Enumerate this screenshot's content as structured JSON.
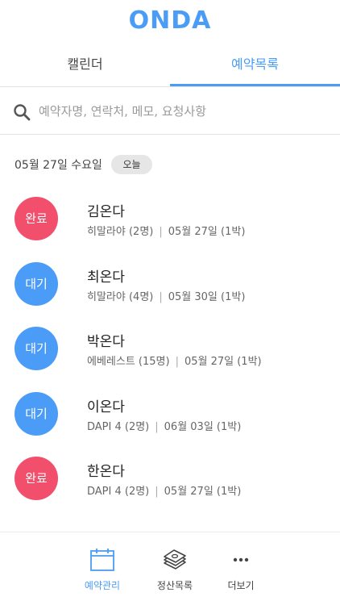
{
  "app": {
    "logo": "ONDA"
  },
  "tabs": [
    {
      "label": "캘린더"
    },
    {
      "label": "예약목록"
    }
  ],
  "search": {
    "placeholder": "예약자명, 연락처, 메모, 요청사항",
    "value": ""
  },
  "date_group": {
    "date": "05월 27일 수요일",
    "badge": "오늘"
  },
  "reservations": [
    {
      "status": "완료",
      "status_color": "#f14f6c",
      "name": "김온다",
      "room": "히말라야 (2명)",
      "checkin": "05월 27일 (1박)"
    },
    {
      "status": "대기",
      "status_color": "#4a9cf6",
      "name": "최온다",
      "room": "히말라야 (4명)",
      "checkin": "05월 30일 (1박)"
    },
    {
      "status": "대기",
      "status_color": "#4a9cf6",
      "name": "박온다",
      "room": "에베레스트 (15명)",
      "checkin": "05월 27일 (1박)"
    },
    {
      "status": "대기",
      "status_color": "#4a9cf6",
      "name": "이온다",
      "room": "DAPI 4 (2명)",
      "checkin": "06월 03일 (1박)"
    },
    {
      "status": "완료",
      "status_color": "#f14f6c",
      "name": "한온다",
      "room": "DAPI 4 (2명)",
      "checkin": "05월 27일 (1박)"
    }
  ],
  "bottom_nav": [
    {
      "label": "예약관리",
      "icon": "calendar-icon",
      "active": true
    },
    {
      "label": "정산목록",
      "icon": "money-stack-icon",
      "active": false
    },
    {
      "label": "더보기",
      "icon": "more-dots-icon",
      "active": false
    }
  ],
  "colors": {
    "accent": "#4a9cf6",
    "done": "#f14f6c",
    "wait": "#4a9cf6"
  }
}
